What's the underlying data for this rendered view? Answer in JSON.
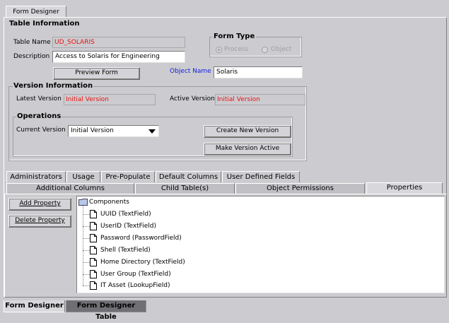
{
  "top_tab": "Form Designer",
  "table_info": {
    "title": "Table Information",
    "table_name_label": "Table Name",
    "table_name_value": "UD_SOLARIS",
    "description_label": "Description",
    "description_value": "Access to Solaris for Engineering",
    "preview_button": "Preview Form",
    "object_name_label": "Object Name",
    "object_name_value": "Solaris"
  },
  "form_type": {
    "title": "Form Type",
    "options": [
      "Process",
      "Object"
    ],
    "selected": "Process"
  },
  "version_info": {
    "title": "Version Information",
    "latest_label": "Latest Version",
    "latest_value": "Initial Version",
    "active_label": "Active Version",
    "active_value": "Initial Version"
  },
  "operations": {
    "title": "Operations",
    "current_label": "Current Version",
    "current_value": "Initial Version",
    "create_button": "Create New Version",
    "activate_button": "Make Version Active"
  },
  "tabs_row1": [
    "Administrators",
    "Usage",
    "Pre-Populate",
    "Default Columns",
    "User Defined Fields"
  ],
  "tabs_row2": [
    "Additional Columns",
    "Child Table(s)",
    "Object Permissions",
    "Properties"
  ],
  "active_tab": "Properties",
  "properties": {
    "add_button": "Add Property",
    "delete_button": "Delete Property",
    "root": "Components",
    "items": [
      "UUID (TextField)",
      "UserID (TextField)",
      "Password (PasswordField)",
      "Shell (TextField)",
      "Home Directory (TextField)",
      "User Group (TextField)",
      "IT Asset (LookupField)"
    ]
  },
  "bottom_tabs": [
    "Form Designer",
    "Form Designer Table"
  ],
  "colors": {
    "background": "#ccccd0",
    "readonly_text": "#e81010",
    "object_name_label": "#1020e0",
    "bottom_tab_inactive": "#707074"
  }
}
